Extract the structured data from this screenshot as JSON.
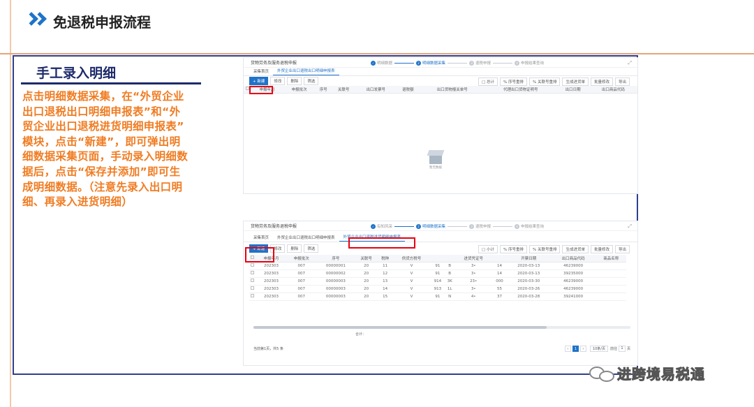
{
  "header": {
    "title": "免退税申报流程"
  },
  "section": {
    "title": "手工录入明细",
    "description": [
      "点击明细数据采集，在“外贸企业",
      "出口退税出口明细申报表”和“外",
      "贸企业出口退税进货明细申报表”",
      "模块，点击“新建”，即可弹出明",
      "细数据采集页面，手动录入明细数",
      "据后，点击“保存并添加”即可生",
      "成明细数据。（注意先录入出口明",
      "细、再录入进货明细）"
    ]
  },
  "screenshot1": {
    "crumb": "货物劳务及服务退税申报",
    "steps": [
      "明细数据",
      "明细数据采集",
      "退税申报",
      "申报结果查询"
    ],
    "tabs": [
      "采集首页",
      "外贸企业出口退税出口明细申报表"
    ],
    "toolbar_left": [
      "+ 新建",
      "修改",
      "删除",
      "筛选"
    ],
    "toolbar_right": [
      "□ 总计",
      "% 序号重排",
      "% 关联号重排",
      "生成进货单",
      "批量修改",
      "导出"
    ],
    "columns": [
      "申报年月",
      "申报批次",
      "序号",
      "关联号",
      "出口发票号",
      "退税额",
      "出口货物报关单号",
      "代理出口货物证明号",
      "出口日期",
      "出口商品代码"
    ],
    "empty_text": "暂无数据"
  },
  "screenshot2": {
    "crumb": "货物劳务及服务退税申报",
    "steps": [
      "有知风采",
      "明细数据采集",
      "退税申报",
      "申报结果查询"
    ],
    "tabs": [
      "采集首页",
      "外贸企业出口退税出口明细申报表",
      "外贸企业出口退税进货明细申报表"
    ],
    "toolbar_left": [
      "+ 新建",
      "修改",
      "删除",
      "筛选"
    ],
    "toolbar_right": [
      "□ 小计",
      "% 序号重排",
      "% 关联号重排",
      "生成进货单",
      "批量修改",
      "导出"
    ],
    "columns": [
      "申报年月",
      "申报批次",
      "序号",
      "关联号",
      "税种",
      "供货方税号",
      "进货凭证号",
      "开票日期",
      "出口商品代码",
      "商品名称"
    ],
    "rows": [
      [
        "202303",
        "007",
        "00000001",
        "20",
        "11",
        "V",
        "91",
        "B",
        "3•",
        "14",
        "2020-03-13",
        "46239000"
      ],
      [
        "202303",
        "007",
        "00000002",
        "20",
        "12",
        "V",
        "91",
        "B",
        "3•",
        "14",
        "2020-03-13",
        "39235000"
      ],
      [
        "202303",
        "007",
        "00000003",
        "20",
        "13",
        "V",
        "914",
        "3K",
        "23•",
        "000",
        "2020-03-30",
        "46239000"
      ],
      [
        "202303",
        "007",
        "00000003",
        "20",
        "14",
        "V",
        "913",
        "1L",
        "3•",
        "55",
        "2020-03-26",
        "46239000"
      ],
      [
        "202303",
        "007",
        "00000003",
        "20",
        "15",
        "V",
        "91",
        "N",
        "4•",
        "37",
        "2020-03-28",
        "39241000"
      ]
    ],
    "sum_label": "合计：",
    "footer_count": "当前第1页，共5 条",
    "page_current": "1",
    "page_size": "10条/页",
    "goto_label": "前往",
    "goto_value": "1",
    "goto_suffix": "页"
  },
  "watermark": {
    "text": "进跨境易税通"
  },
  "colors": {
    "accent": "#1f73c8",
    "highlight_text": "#f07c22",
    "title": "#1d2a6b",
    "red_box": "#e60012"
  }
}
